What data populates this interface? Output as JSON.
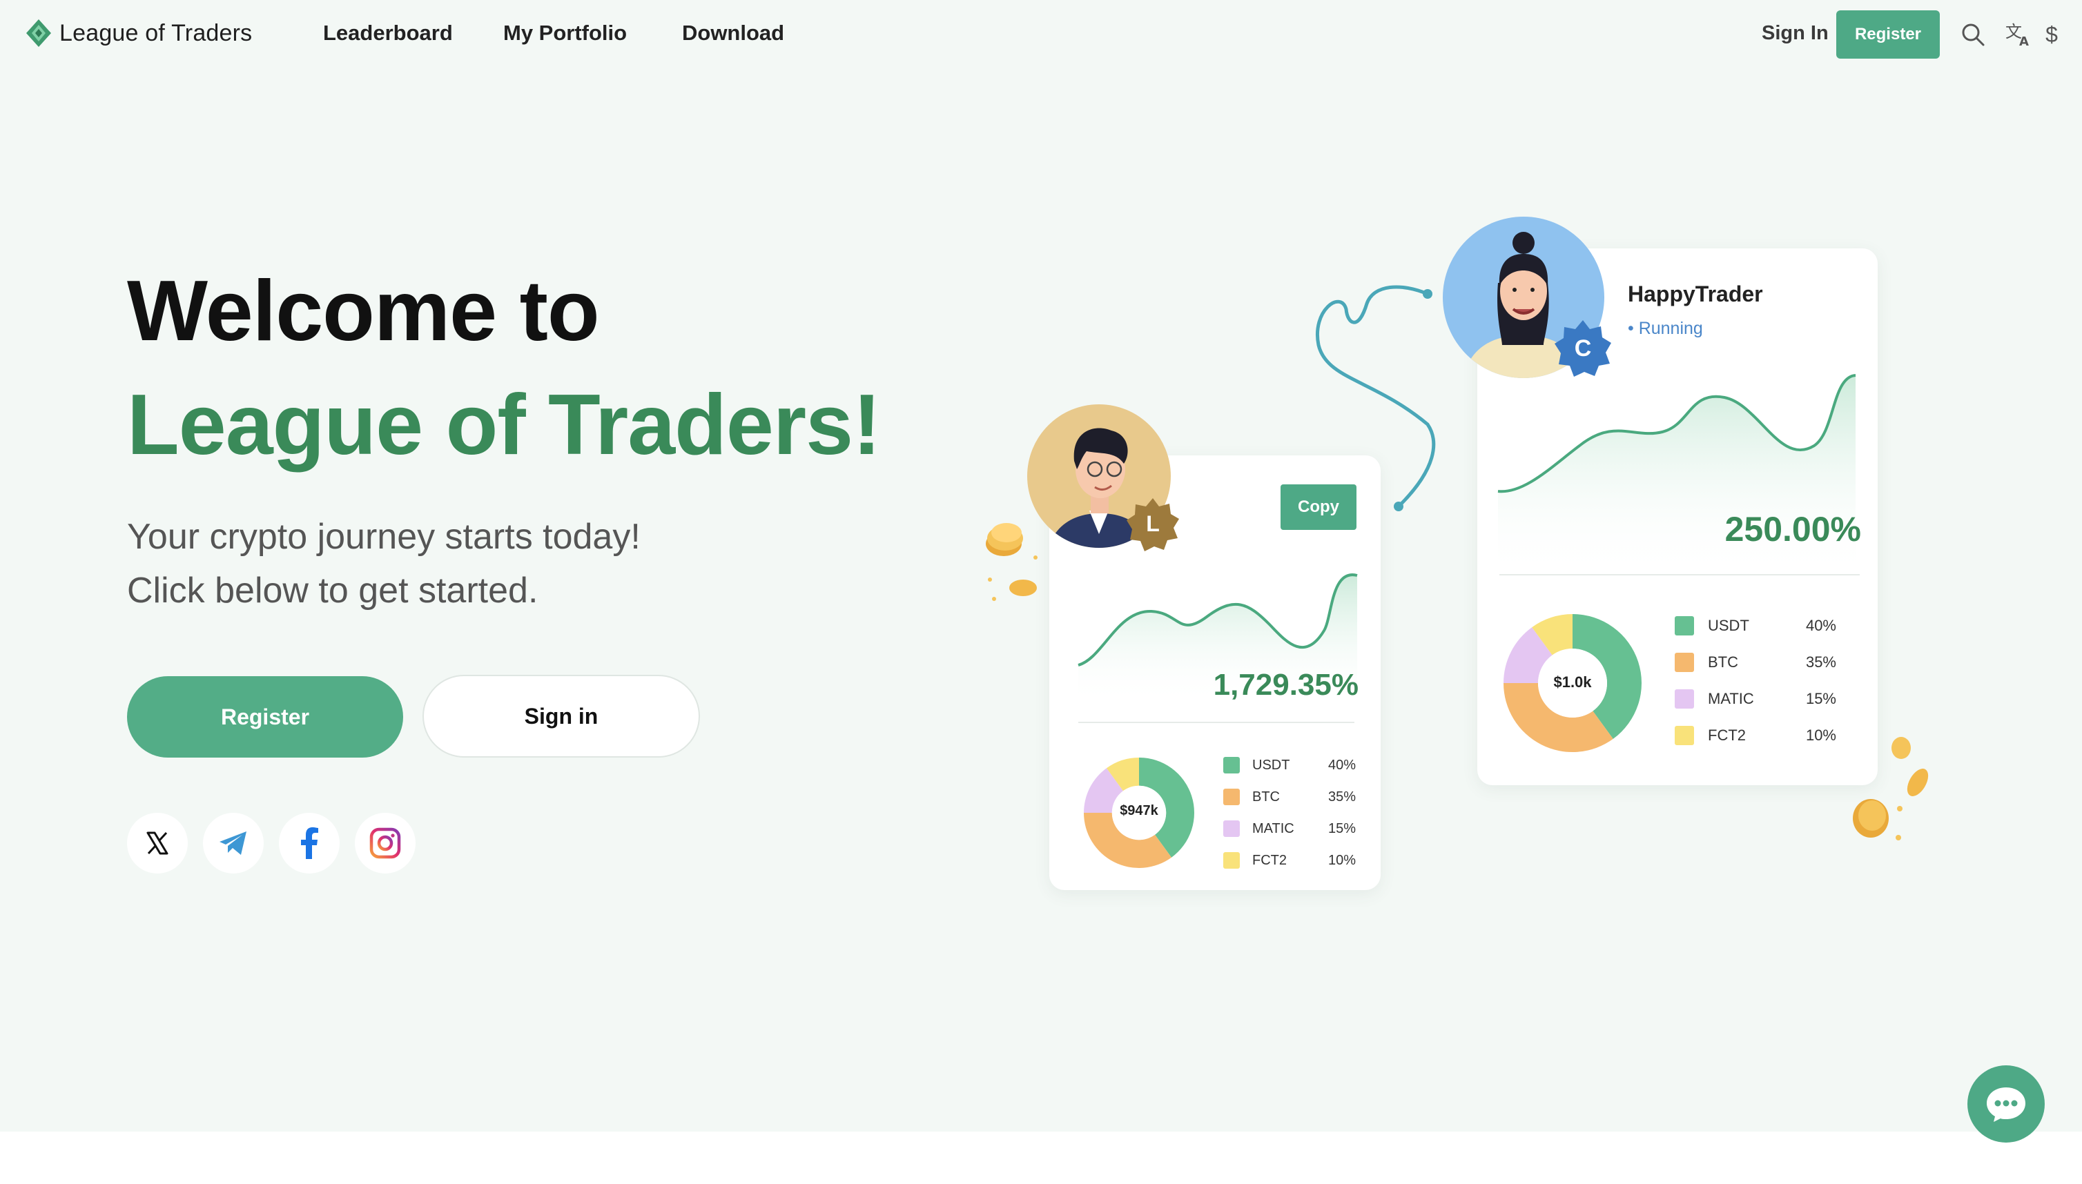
{
  "nav": {
    "logo_text": "League of Traders",
    "links": [
      "Leaderboard",
      "My Portfolio",
      "Download"
    ],
    "sign_in": "Sign In",
    "register": "Register",
    "icons": [
      "search-icon",
      "translate-icon",
      "currency-icon"
    ],
    "currency_symbol": "$"
  },
  "hero": {
    "title_line1": "Welcome to",
    "title_line2": "League of Traders!",
    "subtitle_line1": "Your crypto journey starts today!",
    "subtitle_line2": "Click below to get started.",
    "register_button": "Register",
    "signin_button": "Sign in",
    "social_icons": [
      "x-icon",
      "telegram-icon",
      "facebook-icon",
      "instagram-icon"
    ]
  },
  "card_left": {
    "badge": "L",
    "copy_button": "Copy",
    "return_pct": "1,729.35%",
    "total": "$947k",
    "allocation": [
      {
        "asset": "USDT",
        "pct": "40%",
        "value": 40,
        "color": "#66c092"
      },
      {
        "asset": "BTC",
        "pct": "35%",
        "value": 35,
        "color": "#f5b86e"
      },
      {
        "asset": "MATIC",
        "pct": "15%",
        "value": 15,
        "color": "#e4c6f2"
      },
      {
        "asset": "FCT2",
        "pct": "10%",
        "value": 10,
        "color": "#f9e27a"
      }
    ]
  },
  "card_right": {
    "trader_name": "HappyTrader",
    "status": "• Running",
    "badge": "C",
    "return_pct": "250.00%",
    "total": "$1.0k",
    "allocation": [
      {
        "asset": "USDT",
        "pct": "40%",
        "value": 40,
        "color": "#66c092"
      },
      {
        "asset": "BTC",
        "pct": "35%",
        "value": 35,
        "color": "#f5b86e"
      },
      {
        "asset": "MATIC",
        "pct": "15%",
        "value": 15,
        "color": "#e4c6f2"
      },
      {
        "asset": "FCT2",
        "pct": "10%",
        "value": 10,
        "color": "#f9e27a"
      }
    ]
  },
  "colors": {
    "brand_green": "#4ea986",
    "title_green": "#3a8a59",
    "background": "#f3f8f5",
    "status_blue": "#4a86c9"
  },
  "chat_button_icon": "chat-bubble-icon"
}
